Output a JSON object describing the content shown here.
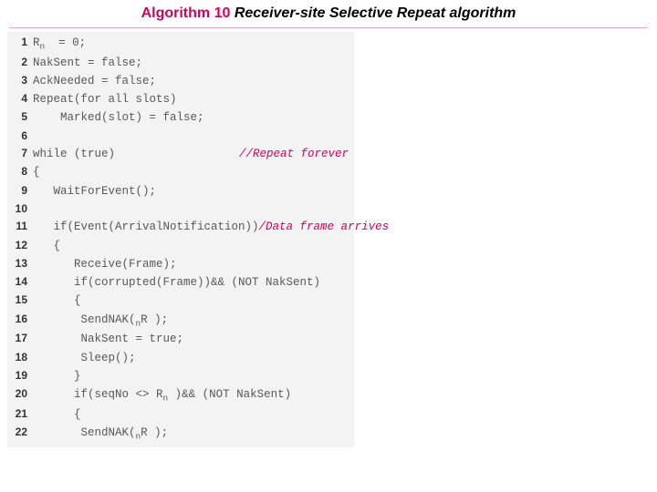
{
  "title": {
    "highlight": "Algorithm 10",
    "rest": "  Receiver-site Selective Repeat algorithm"
  },
  "listing": {
    "lines": [
      {
        "n": "1",
        "code": "R  = 0;",
        "sub_after_first_char": "n"
      },
      {
        "n": "2",
        "code": "NakSent = false;"
      },
      {
        "n": "3",
        "code": "AckNeeded = false;"
      },
      {
        "n": "4",
        "code": "Repeat(for all slots)"
      },
      {
        "n": "5",
        "code": "    Marked(slot) = false;"
      },
      {
        "n": "6",
        "code": ""
      },
      {
        "n": "7",
        "code": "while (true)",
        "comment": "//Repeat forever"
      },
      {
        "n": "8",
        "code": "{"
      },
      {
        "n": "9",
        "code": "   WaitForEvent();"
      },
      {
        "n": "10",
        "code": ""
      },
      {
        "n": "11",
        "code": "   if(Event(ArrivalNotification))",
        "comment": "/Data frame arrives"
      },
      {
        "n": "12",
        "code": "   {"
      },
      {
        "n": "13",
        "code": "      Receive(Frame);"
      },
      {
        "n": "14",
        "code": "      if(corrupted(Frame))&& (NOT NakSent)"
      },
      {
        "n": "15",
        "code": "      {"
      },
      {
        "n": "16",
        "code": "       SendNAK(R );",
        "sub_at": 15,
        "sub": "n"
      },
      {
        "n": "17",
        "code": "       NakSent = true;"
      },
      {
        "n": "18",
        "code": "       Sleep();"
      },
      {
        "n": "19",
        "code": "      }"
      },
      {
        "n": "20",
        "code": "      if(seqNo <> R )&& (NOT NakSent)",
        "sub_at": 19,
        "sub": "n"
      },
      {
        "n": "21",
        "code": "      {"
      },
      {
        "n": "22",
        "code": "       SendNAK(R );",
        "sub_at": 15,
        "sub": "n"
      }
    ]
  }
}
